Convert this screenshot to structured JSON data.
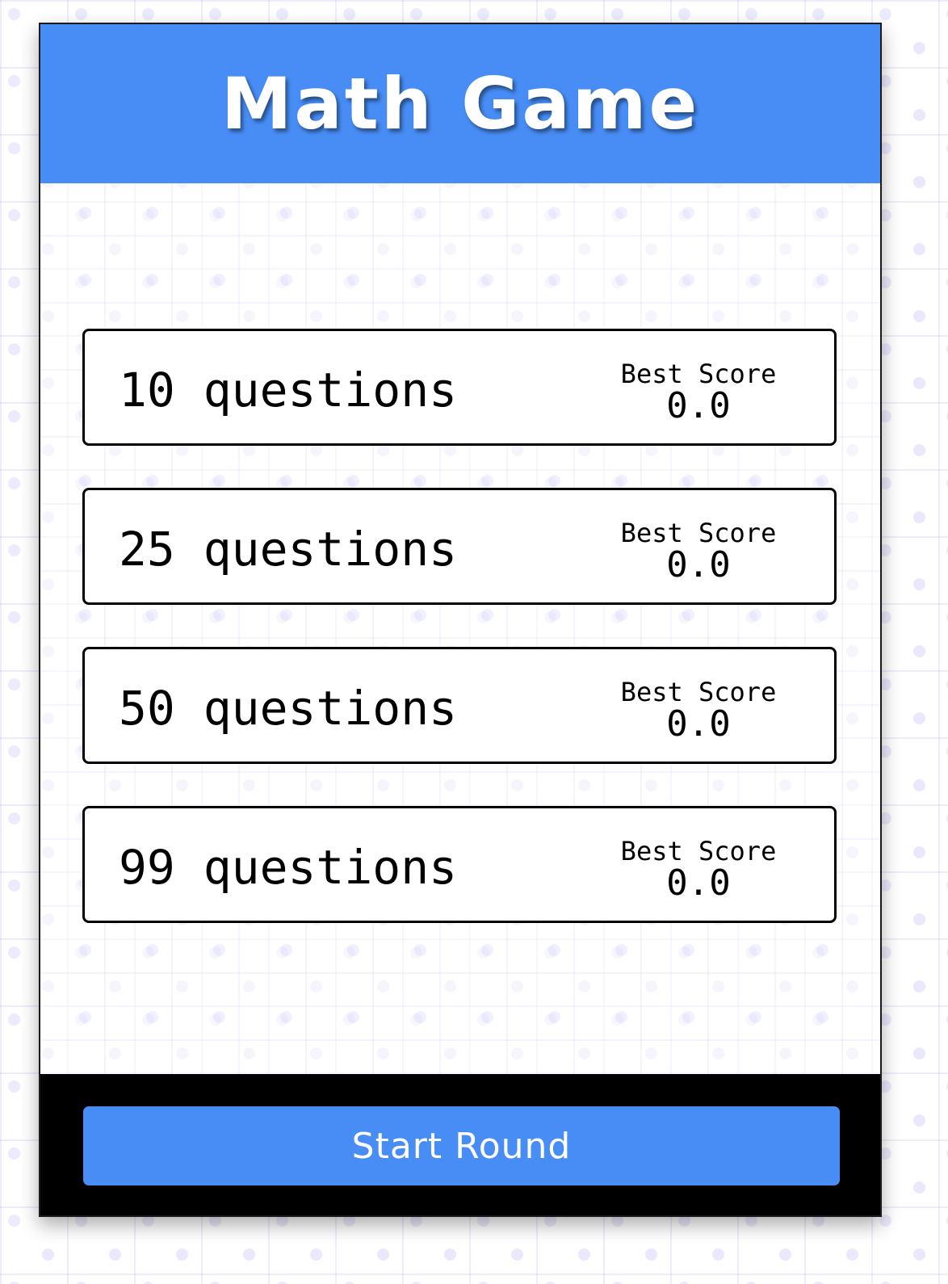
{
  "app": {
    "title": "Math Game"
  },
  "options": [
    {
      "label": "10 questions",
      "best_score_label": "Best Score",
      "best_score": "0.0"
    },
    {
      "label": "25 questions",
      "best_score_label": "Best Score",
      "best_score": "0.0"
    },
    {
      "label": "50 questions",
      "best_score_label": "Best Score",
      "best_score": "0.0"
    },
    {
      "label": "99 questions",
      "best_score_label": "Best Score",
      "best_score": "0.0"
    }
  ],
  "footer": {
    "start_label": "Start Round"
  },
  "colors": {
    "accent": "#478df5",
    "footer_background": "#000000",
    "text": "#000000",
    "grid": "#e8e6fd"
  }
}
